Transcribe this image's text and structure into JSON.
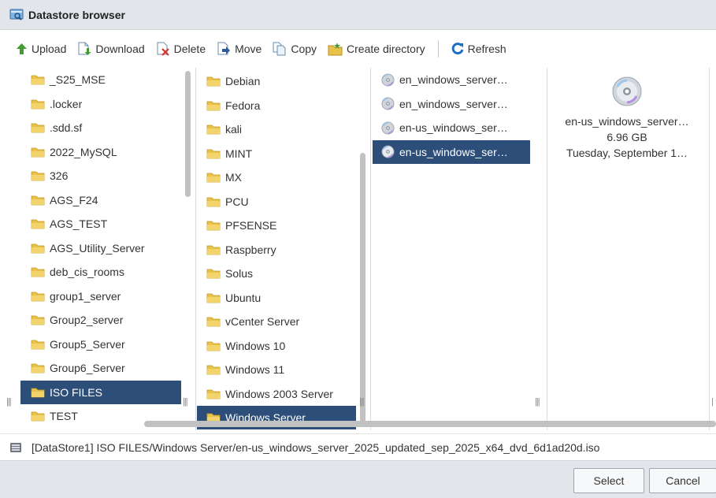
{
  "window": {
    "title": "Datastore browser"
  },
  "toolbar": {
    "upload": "Upload",
    "download": "Download",
    "delete": "Delete",
    "move": "Move",
    "copy": "Copy",
    "create_directory": "Create directory",
    "refresh": "Refresh"
  },
  "columns": {
    "datastore_folders": [
      "_S25_MSE",
      ".locker",
      ".sdd.sf",
      "2022_MySQL",
      "326",
      "AGS_F24",
      "AGS_TEST",
      "AGS_Utility_Server",
      "deb_cis_rooms",
      "group1_server",
      "Group2_server",
      "Group5_Server",
      "Group6_Server",
      "ISO FILES",
      "TEST"
    ],
    "datastore_selected": "ISO FILES",
    "iso_folders": [
      "Debian",
      "Fedora",
      "kali",
      "MINT",
      "MX",
      "PCU",
      "PFSENSE",
      "Raspberry",
      "Solus",
      "Ubuntu",
      "vCenter Server",
      "Windows 10",
      "Windows 11",
      "Windows 2003 Server",
      "Windows Server"
    ],
    "iso_selected": "Windows Server",
    "files": [
      "en_windows_server…",
      "en_windows_server…",
      "en-us_windows_ser…",
      "en-us_windows_ser…"
    ],
    "file_selected_index": 3
  },
  "detail": {
    "icon": "disc-icon",
    "name": "en-us_windows_server…",
    "size": "6.96 GB",
    "modified": "Tuesday, September 1…"
  },
  "path": {
    "text": "[DataStore1] ISO FILES/Windows Server/en-us_windows_server_2025_updated_sep_2025_x64_dvd_6d1ad20d.iso"
  },
  "buttons": {
    "select": "Select",
    "cancel": "Cancel"
  },
  "colors": {
    "selection": "#2d4e78",
    "folder": "#e9c24a",
    "refresh_accent": "#1b6ec2",
    "upload_accent": "#3f9c2f"
  }
}
